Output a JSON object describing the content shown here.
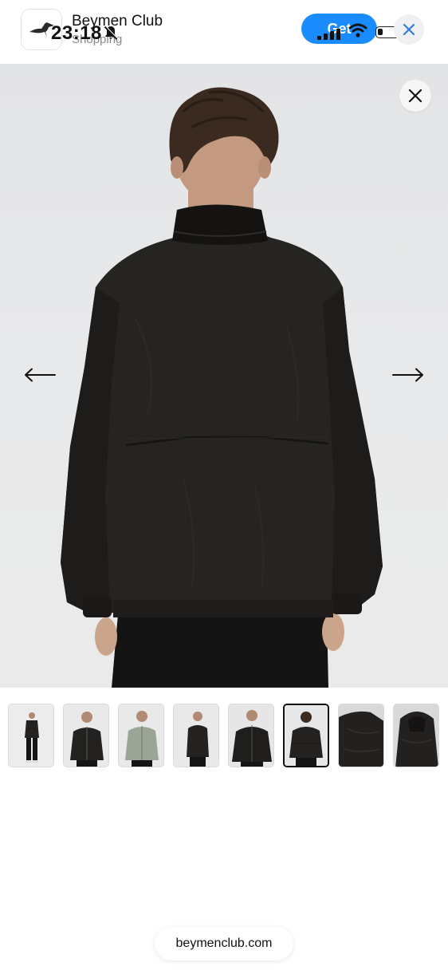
{
  "status_bar": {
    "time": "23:18"
  },
  "app_banner": {
    "app_name": "Beymen Club",
    "category": "Shopping",
    "get_label": "Get",
    "accent_color": "#1a8cff",
    "icons": [
      "duck-logo-icon",
      "bell-muted-icon",
      "cellular-signal-icon",
      "wifi-icon",
      "battery-icon",
      "close-icon"
    ]
  },
  "gallery": {
    "current_image_index": 6,
    "image_count": 8,
    "icons": [
      "close-icon",
      "arrow-left-icon",
      "arrow-right-icon"
    ],
    "thumbnails": [
      {
        "view": "full-body front"
      },
      {
        "view": "front"
      },
      {
        "view": "front sage jacket"
      },
      {
        "view": "side"
      },
      {
        "view": "front three-quarter"
      },
      {
        "view": "back"
      },
      {
        "view": "shoulder detail"
      },
      {
        "view": "hood detail"
      }
    ]
  },
  "url_bar": {
    "domain": "beymenclub.com"
  }
}
